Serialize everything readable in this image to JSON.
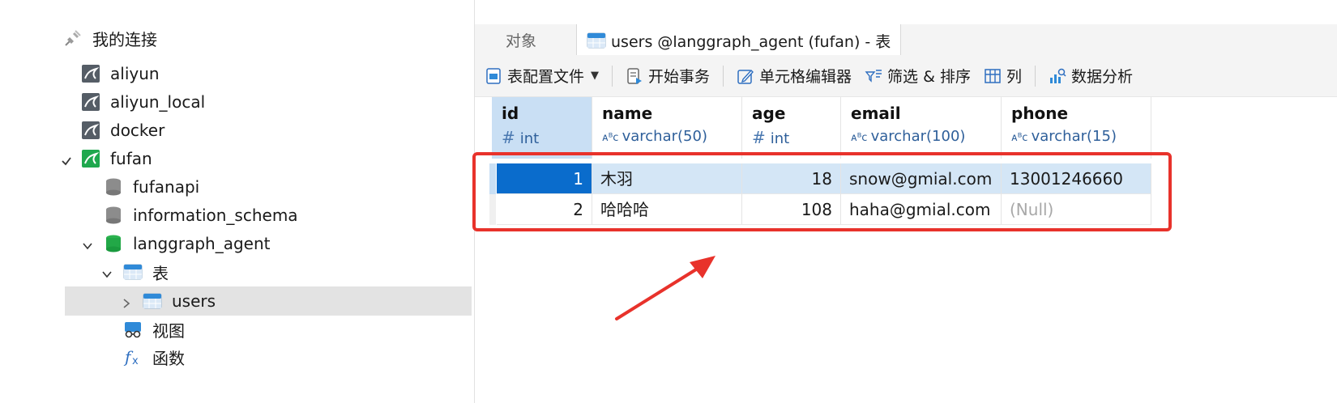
{
  "sidebar": {
    "root_label": "我的连接",
    "items": [
      {
        "label": "aliyun",
        "icon": "mysql-connection-icon"
      },
      {
        "label": "aliyun_local",
        "icon": "mysql-connection-icon"
      },
      {
        "label": "docker",
        "icon": "mysql-connection-icon"
      },
      {
        "label": "fufan",
        "icon": "mysql-connection-active-icon"
      },
      {
        "label": "fufanapi",
        "icon": "database-icon"
      },
      {
        "label": "information_schema",
        "icon": "database-icon"
      },
      {
        "label": "langgraph_agent",
        "icon": "database-active-icon"
      },
      {
        "label": "表",
        "icon": "table-folder-icon"
      },
      {
        "label": "users",
        "icon": "table-icon"
      },
      {
        "label": "视图",
        "icon": "view-icon"
      },
      {
        "label": "函数",
        "icon": "function-icon"
      }
    ]
  },
  "tabs": {
    "objects_label": "对象",
    "active_label": "users @langgraph_agent (fufan) - 表"
  },
  "toolbar": {
    "profile_label": "表配置文件",
    "transaction_label": "开始事务",
    "cell_editor_label": "单元格编辑器",
    "filter_sort_label": "筛选 & 排序",
    "columns_label": "列",
    "data_analysis_label": "数据分析"
  },
  "table": {
    "columns": [
      {
        "name": "id",
        "type": "int",
        "type_icon": "#"
      },
      {
        "name": "name",
        "type": "varchar(50)",
        "type_icon": "ABC"
      },
      {
        "name": "age",
        "type": "int",
        "type_icon": "#"
      },
      {
        "name": "email",
        "type": "varchar(100)",
        "type_icon": "ABC"
      },
      {
        "name": "phone",
        "type": "varchar(15)",
        "type_icon": "ABC"
      }
    ],
    "rows": [
      {
        "id": "1",
        "name": "木羽",
        "age": "18",
        "email": "snow@gmial.com",
        "phone": "13001246660"
      },
      {
        "id": "2",
        "name": "哈哈哈",
        "age": "108",
        "email": "haha@gmial.com",
        "phone": "(Null)"
      }
    ]
  },
  "colors": {
    "highlight_box": "#e8322b",
    "selected_cell": "#0a6ccc",
    "selected_row": "#d4e6f6",
    "id_header": "#c9dff4"
  }
}
